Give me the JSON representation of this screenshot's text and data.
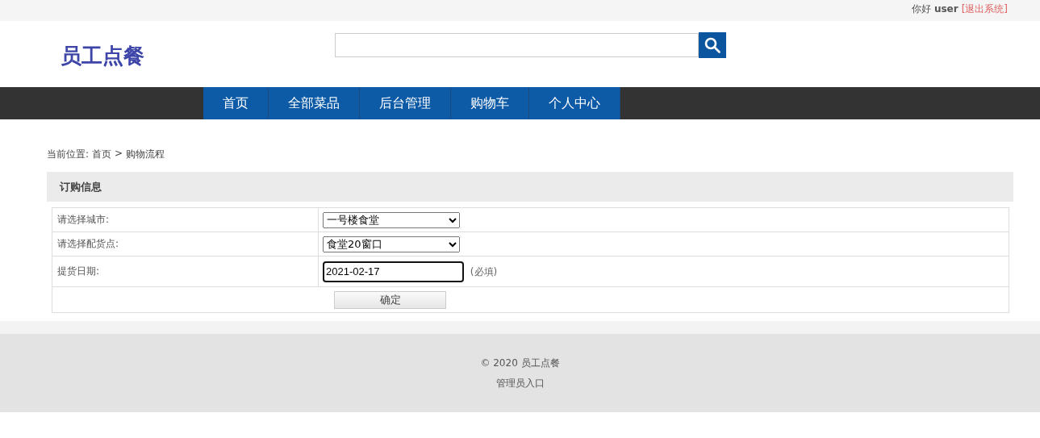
{
  "top_bar": {
    "greeting": "你好 **user**",
    "logout_link": "[退出系统]"
  },
  "header": {
    "logo": "员工点餐"
  },
  "nav": [
    {
      "label": "首页"
    },
    {
      "label": "全部菜品"
    },
    {
      "label": "后台管理"
    },
    {
      "label": "购物车"
    },
    {
      "label": "个人中心"
    }
  ],
  "breadcrumb": {
    "prefix": "当前位置:",
    "home": "首页",
    "separator": ">",
    "current": "购物流程"
  },
  "section_title": "订购信息",
  "form": {
    "rows": [
      {
        "kind": "select",
        "label": "请选择城市:",
        "value": "一号楼食堂"
      },
      {
        "kind": "select",
        "label": "请选择配货点:",
        "value": "食堂20窗口"
      },
      {
        "kind": "date",
        "label": "提货日期:",
        "value": "2021-02-17",
        "note": "(必填)"
      }
    ],
    "submit": "确定"
  },
  "footer": {
    "copyright": "© 2020 员工点餐",
    "admin_link": "管理员入口"
  }
}
